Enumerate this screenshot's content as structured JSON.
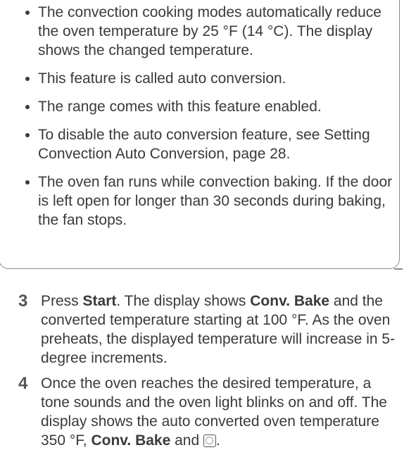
{
  "note": {
    "bullets": [
      "The convection cooking modes automatically reduce the oven temperature by 25 °F (14 °C). The display shows the changed temperature.",
      "This feature is called auto conversion.",
      "The range comes with this feature enabled.",
      "To disable the auto conversion feature, see Setting Convection Auto Conversion, page 28.",
      "The oven fan runs while convection baking. If the door is left open for longer than 30 seconds during baking, the fan stops."
    ]
  },
  "steps": [
    {
      "number": "3",
      "parts": {
        "t1": "Press ",
        "b1": "Start",
        "t2": ". The display shows ",
        "b2": "Conv. Bake",
        "t3": " and the converted temperature starting at 100 °F. As the oven preheats, the displayed temperature will increase in 5-degree increments."
      }
    },
    {
      "number": "4",
      "parts": {
        "t1": "Once the oven reaches the desired temperature, a tone sounds and the oven light blinks on and off. The display shows the auto converted oven temperature 350 °F, ",
        "b1": "Conv. Bake",
        "t2": " and ",
        "t3": "."
      },
      "icon": "convection-fan-icon"
    }
  ]
}
